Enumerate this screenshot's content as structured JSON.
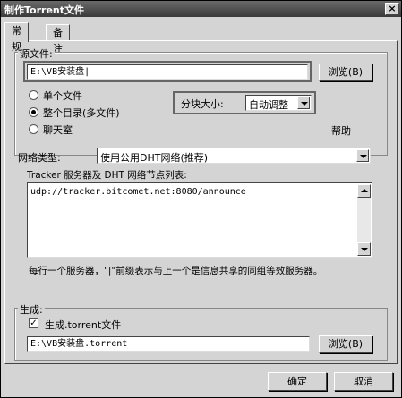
{
  "window": {
    "title": "制作Torrent文件",
    "close_icon": "close-icon"
  },
  "tabs": [
    {
      "label": "常规"
    },
    {
      "label": "备注"
    }
  ],
  "source": {
    "group_label": "源文件:",
    "path": "E:\\VB安装盘|",
    "browse_label": "浏览(B)",
    "radio_single": "单个文件",
    "radio_dir": "整个目录(多文件)",
    "radio_chat": "聊天室",
    "selected_radio": "radio_dir",
    "piece_size_label": "分块大小:",
    "piece_size_value": "自动调整",
    "help_label": "帮助"
  },
  "network": {
    "type_label": "网络类型:",
    "type_value": "使用公用DHT网络(推荐)",
    "tracker_list_label": "Tracker 服务器及 DHT 网络节点列表:",
    "tracker_text": "udp://tracker.bitcomet.net:8080/announce",
    "hint": "每行一个服务器，\"|\"前缀表示与上一个是信息共享的同组等效服务器。"
  },
  "generate": {
    "group_label": "生成:",
    "checkbox_label": "生成.torrent文件",
    "checked": true,
    "output_path": "E:\\VB安装盘.torrent",
    "browse_label": "浏览(B)"
  },
  "footer": {
    "ok_label": "确定",
    "cancel_label": "取消"
  }
}
